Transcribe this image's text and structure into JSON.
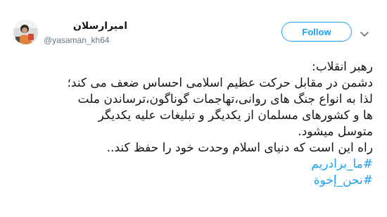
{
  "author": {
    "display_name": "امیرارسلان",
    "handle": "@yasaman_kh64",
    "avatar_icon": "profile-photo"
  },
  "actions": {
    "follow_label": "Follow",
    "menu_icon": "chevron-down-icon"
  },
  "colors": {
    "accent": "#1da1f2",
    "text": "#14171a",
    "muted": "#657786"
  },
  "tweet": {
    "lines": [
      "رهبر انقلاب:",
      "دشمن در مقابل حرکت عظیم اسلامی احساس ضعف می کند؛",
      "لذا به انواع جنگ های روانی،تهاجمات گوناگون،ترساندن ملت",
      "ها و کشورهای مسلمان از یکدیگر و تبلیغات علیه یکدیگر",
      "متوسل میشود.",
      "راه این است که دنیای اسلام وحدت خود را حفظ کند.."
    ],
    "hashtags": [
      "#ما_برادریم",
      "#نحن_إخوة"
    ]
  }
}
